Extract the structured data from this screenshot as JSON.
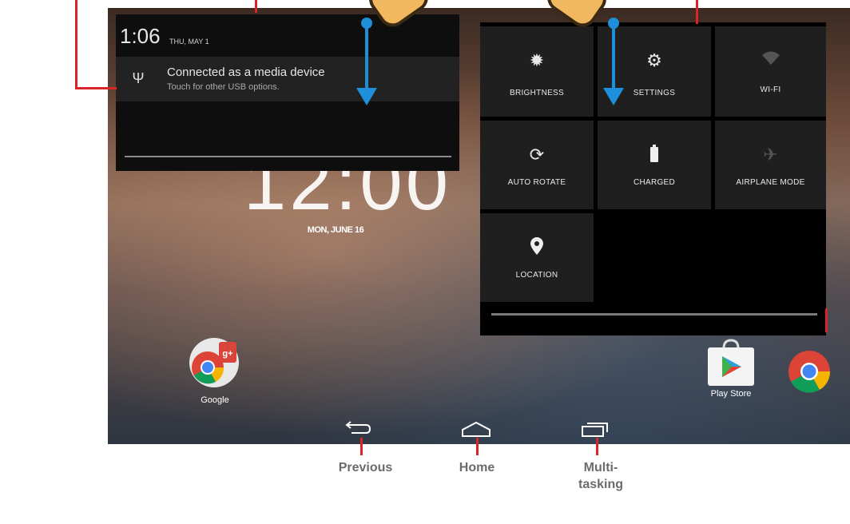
{
  "notification": {
    "time": "1:06",
    "day": "THU, MAY 1",
    "title": "Connected as a media device",
    "subtitle": "Touch for other USB options."
  },
  "lockscreen": {
    "clock": "12:00",
    "date": "MON, JUNE 16"
  },
  "quick_settings": [
    {
      "label": "BRIGHTNESS",
      "icon": "brightness-icon"
    },
    {
      "label": "SETTINGS",
      "icon": "settings-gear-icon"
    },
    {
      "label": "WI-FI",
      "icon": "wifi-icon"
    },
    {
      "label": "AUTO ROTATE",
      "icon": "auto-rotate-icon"
    },
    {
      "label": "CHARGED",
      "icon": "battery-icon"
    },
    {
      "label": "AIRPLANE MODE",
      "icon": "airplane-icon"
    },
    {
      "label": "LOCATION",
      "icon": "location-pin-icon"
    }
  ],
  "apps": {
    "google": "Google",
    "play_store": "Play Store"
  },
  "nav": {
    "previous": "Previous",
    "home": "Home",
    "multitasking_line1": "Multi-",
    "multitasking_line2": "tasking"
  },
  "colors": {
    "annotation": "#d9252a",
    "arrow": "#1e8fd8"
  }
}
